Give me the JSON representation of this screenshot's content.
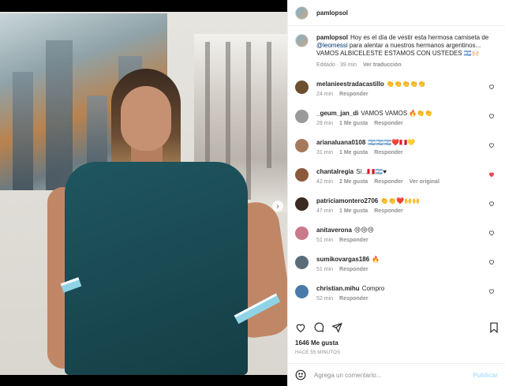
{
  "owner": {
    "username": "pamlopsol"
  },
  "caption": {
    "username": "pamlopsol",
    "text_before": "Hoy es el día de vestir esta hermosa camiseta de ",
    "mention": "@leomessi",
    "text_after": " para alentar a nuestros hermanos argentinos... VAMOS ALBICELESTE ESTAMOS CON USTEDES 🇦🇷🙌🏻",
    "edited_label": "Editado · 39 min",
    "translate_label": "Ver traducción"
  },
  "comments": [
    {
      "username": "melanieestradacastillo",
      "text": "👏👏👏👏👏",
      "time": "24 min",
      "likes": "",
      "reply": "Responder",
      "extra": "",
      "liked": false,
      "avatar_color": "#6b4f2e"
    },
    {
      "username": "_geum_jan_di",
      "text": "VAMOS VAMOS 🔥👏👏",
      "time": "28 min",
      "likes": "1 Me gusta",
      "reply": "Responder",
      "extra": "",
      "liked": false,
      "avatar_color": "#9a9a9a"
    },
    {
      "username": "arianaluana0108",
      "text": "🇦🇷🇦🇷🇦🇷❤️🇵🇪💛",
      "time": "31 min",
      "likes": "1 Me gusta",
      "reply": "Responder",
      "extra": "",
      "liked": false,
      "avatar_color": "#a57a5c"
    },
    {
      "username": "chantalregia",
      "text": "Sí...🇵🇪🇦🇷♥",
      "time": "42 min",
      "likes": "2 Me gusta",
      "reply": "Responder",
      "extra": "Ver original",
      "liked": true,
      "avatar_color": "#8b5a3c"
    },
    {
      "username": "patriciamontero2706",
      "text": "👏👏❤️🙌🙌",
      "time": "47 min",
      "likes": "1 Me gusta",
      "reply": "Responder",
      "extra": "",
      "liked": false,
      "avatar_color": "#3b2a22"
    },
    {
      "username": "anitaverona",
      "text": "😢😢😢",
      "time": "51 min",
      "likes": "",
      "reply": "Responder",
      "extra": "",
      "liked": false,
      "avatar_color": "#c97a8a"
    },
    {
      "username": "sumikovargas186",
      "text": "🔥",
      "time": "51 min",
      "likes": "",
      "reply": "Responder",
      "extra": "",
      "liked": false,
      "avatar_color": "#5a6c7a"
    },
    {
      "username": "christian.mihu",
      "text": "Compro",
      "time": "52 min",
      "likes": "",
      "reply": "Responder",
      "extra": "",
      "liked": false,
      "avatar_color": "#4a7aa8"
    }
  ],
  "stats": {
    "likes": "1646 Me gusta",
    "time_ago": "HACE 55 MINUTOS"
  },
  "add_comment": {
    "placeholder": "Agrega un comentario...",
    "publish_label": "Publicar"
  },
  "colors": {
    "mention": "#00376b",
    "muted": "#8e8e8e",
    "like_red": "#ed4956",
    "publish_disabled": "#b2dffc"
  }
}
